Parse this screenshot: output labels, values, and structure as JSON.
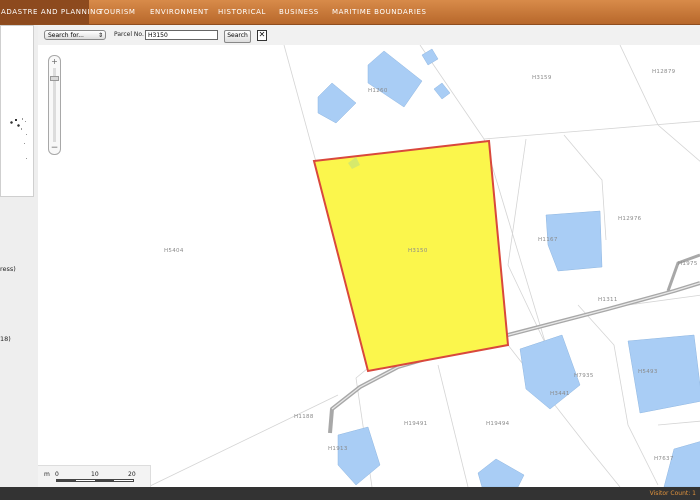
{
  "nav": {
    "tabs": [
      {
        "label": "ADASTRE AND PLANNING",
        "active": true
      },
      {
        "label": "TOURISM",
        "active": false
      },
      {
        "label": "ENVIRONMENT",
        "active": false
      },
      {
        "label": "HISTORICAL",
        "active": false
      },
      {
        "label": "BUSINESS",
        "active": false
      },
      {
        "label": "MARITIME BOUNDARIES",
        "active": false
      }
    ],
    "accent": "#c27231",
    "active_bg": "#8d4a1e"
  },
  "sidebar": {
    "fragment_1": "ress)",
    "fragment_2": "18)"
  },
  "toolbar": {
    "search_select": "Search for...",
    "parcel_label": "Parcel No.",
    "parcel_value": "H3150",
    "search_button": "Search",
    "clear_icon": "close-box-icon"
  },
  "map": {
    "colors": {
      "parcel_fill": "#fbf64c",
      "parcel_stroke": "#d9483c",
      "building": "#a9cdf5",
      "parcel_line": "#d4d4d4",
      "road": "#a8a8a8"
    },
    "parcel_labels": [
      "H3150",
      "H1260",
      "H3159",
      "H12879",
      "H5404",
      "H12976",
      "H1167",
      "H1975",
      "H7935",
      "H5493",
      "H1188",
      "H19491",
      "H19494",
      "H3441",
      "H1913",
      "H7637",
      "H1311"
    ],
    "zoom_in": "+",
    "zoom_out": "−",
    "scale": {
      "unit": "m",
      "ticks": [
        "0",
        "10",
        "20"
      ]
    }
  },
  "status": {
    "visitor": "Visitor Count: 1"
  }
}
